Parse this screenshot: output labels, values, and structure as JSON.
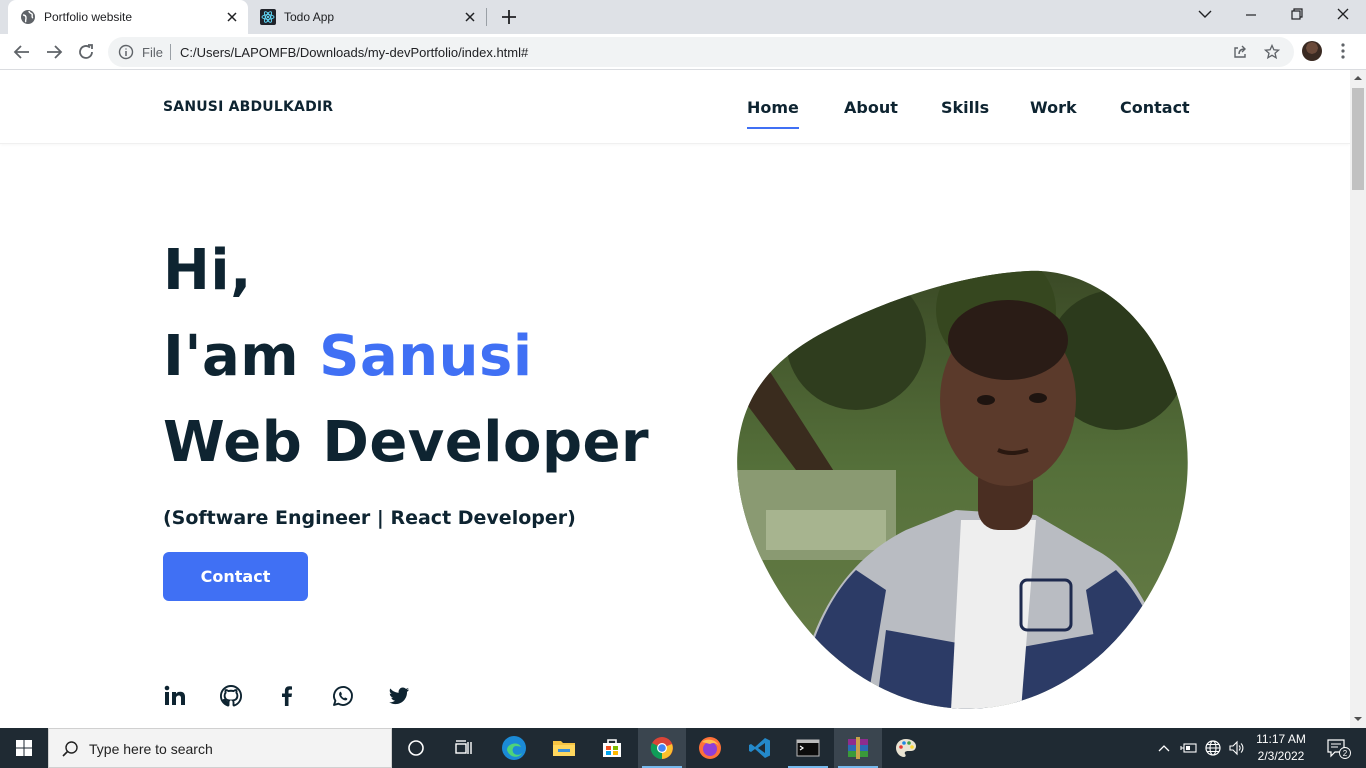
{
  "browser": {
    "tabs": [
      {
        "title": "Portfolio website",
        "active": true,
        "favicon": "globe-icon"
      },
      {
        "title": "Todo App",
        "active": false,
        "favicon": "react-icon"
      }
    ],
    "url_scheme_label": "File",
    "url": "C:/Users/LAPOMFB/Downloads/my-devPortfolio/index.html#"
  },
  "site": {
    "logo": "SANUSI ABDULKADIR",
    "nav": [
      {
        "label": "Home",
        "active": true
      },
      {
        "label": "About",
        "active": false
      },
      {
        "label": "Skills",
        "active": false
      },
      {
        "label": "Work",
        "active": false
      },
      {
        "label": "Contact",
        "active": false
      }
    ],
    "hero": {
      "line1": "Hi,",
      "line2_prefix": "I'am ",
      "line2_name": "Sanusi",
      "line3": "Web Developer",
      "subtitle": "(Software Engineer | React Developer)",
      "cta_label": "Contact"
    },
    "social_icons": [
      "linkedin-icon",
      "github-icon",
      "facebook-icon",
      "whatsapp-icon",
      "twitter-icon"
    ],
    "colors": {
      "accent": "#4070f4",
      "text": "#0e2431"
    }
  },
  "taskbar": {
    "search_placeholder": "Type here to search",
    "time": "11:17 AM",
    "date": "2/3/2022",
    "notification_count": "2"
  }
}
